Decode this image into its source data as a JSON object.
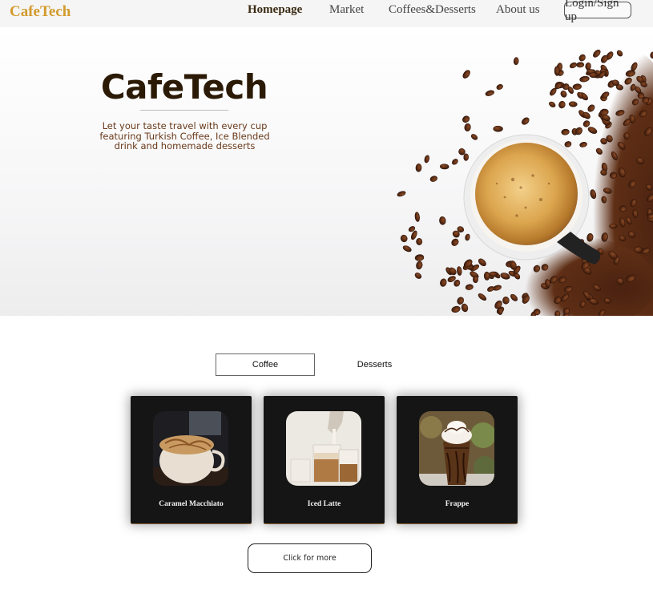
{
  "nav": {
    "brand": "CafeTech",
    "links": [
      "Homepage",
      "Market",
      "Coffees&Desserts",
      "About us"
    ],
    "login": "Login/Sign up"
  },
  "hero": {
    "title": "CafeTech",
    "subtitle_lines": [
      "Let your taste travel with every cup",
      "featuring Turkish Coffee, Ice Blended",
      "drink and homemade desserts"
    ]
  },
  "tabs": {
    "coffee": "Coffee",
    "desserts": "Desserts"
  },
  "products": [
    {
      "name": "Caramel Macchiato"
    },
    {
      "name": "Iced Latte"
    },
    {
      "name": "Frappe"
    }
  ],
  "more_button": "Click for more",
  "colors": {
    "brand": "#d39a2c",
    "card_bg": "#151515",
    "title": "#2b1a06"
  }
}
